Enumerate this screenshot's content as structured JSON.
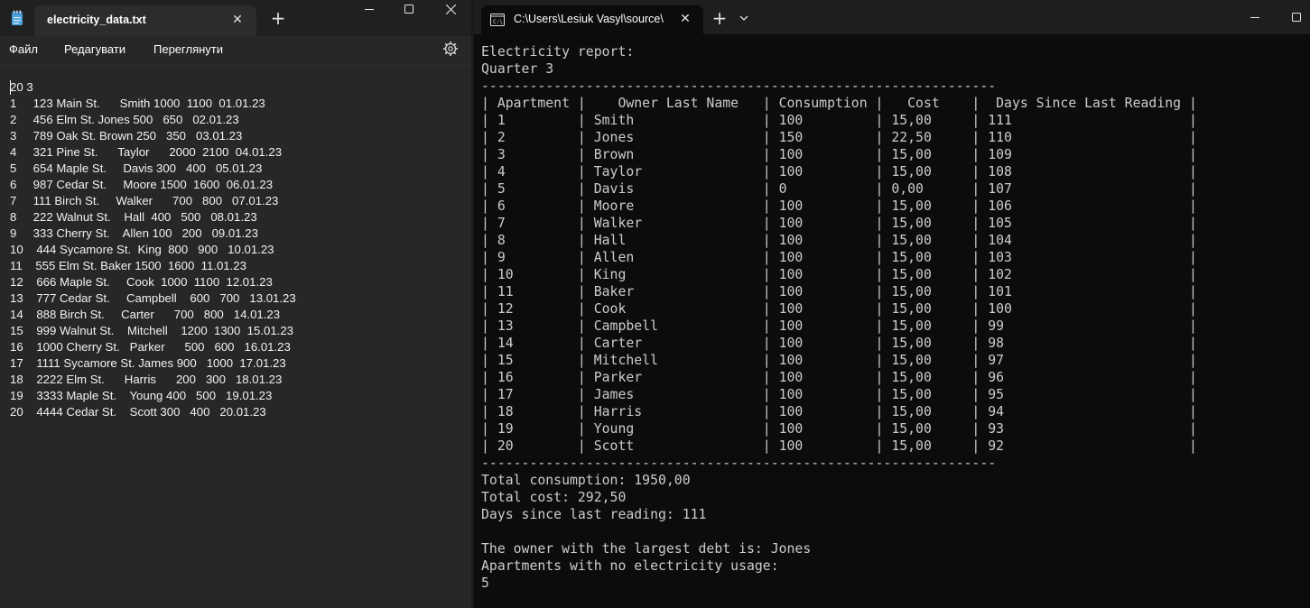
{
  "notepad": {
    "tab_title": "electricity_data.txt",
    "menu": [
      "Файл",
      "Редагувати",
      "Переглянути"
    ],
    "lines": [
      "20 3",
      "1     123 Main St.      Smith 1000  1100  01.01.23",
      "2     456 Elm St. Jones 500   650   02.01.23",
      "3     789 Oak St. Brown 250   350   03.01.23",
      "4     321 Pine St.      Taylor      2000  2100  04.01.23",
      "5     654 Maple St.     Davis 300   400   05.01.23",
      "6     987 Cedar St.     Moore 1500  1600  06.01.23",
      "7     111 Birch St.     Walker      700   800   07.01.23",
      "8     222 Walnut St.    Hall  400   500   08.01.23",
      "9     333 Cherry St.    Allen 100   200   09.01.23",
      "10    444 Sycamore St.  King  800   900   10.01.23",
      "11    555 Elm St. Baker 1500  1600  11.01.23",
      "12    666 Maple St.     Cook  1000  1100  12.01.23",
      "13    777 Cedar St.     Campbell    600   700   13.01.23",
      "14    888 Birch St.     Carter      700   800   14.01.23",
      "15    999 Walnut St.    Mitchell    1200  1300  15.01.23",
      "16    1000 Cherry St.   Parker      500   600   16.01.23",
      "17    1111 Sycamore St. James 900   1000  17.01.23",
      "18    2222 Elm St.      Harris      200   300   18.01.23",
      "19    3333 Maple St.    Young 400   500   19.01.23",
      "20    4444 Cedar St.    Scott 300   400   20.01.23"
    ]
  },
  "terminal": {
    "tab_title": "C:\\Users\\Lesiuk Vasyl\\source\\",
    "lines": [
      "Electricity report:",
      "Quarter 3",
      "----------------------------------------------------------------",
      "| Apartment |    Owner Last Name   | Consumption |   Cost    |  Days Since Last Reading |",
      "| 1         | Smith                | 100         | 15,00     | 111                      |",
      "| 2         | Jones                | 150         | 22,50     | 110                      |",
      "| 3         | Brown                | 100         | 15,00     | 109                      |",
      "| 4         | Taylor               | 100         | 15,00     | 108                      |",
      "| 5         | Davis                | 0           | 0,00      | 107                      |",
      "| 6         | Moore                | 100         | 15,00     | 106                      |",
      "| 7         | Walker               | 100         | 15,00     | 105                      |",
      "| 8         | Hall                 | 100         | 15,00     | 104                      |",
      "| 9         | Allen                | 100         | 15,00     | 103                      |",
      "| 10        | King                 | 100         | 15,00     | 102                      |",
      "| 11        | Baker                | 100         | 15,00     | 101                      |",
      "| 12        | Cook                 | 100         | 15,00     | 100                      |",
      "| 13        | Campbell             | 100         | 15,00     | 99                       |",
      "| 14        | Carter               | 100         | 15,00     | 98                       |",
      "| 15        | Mitchell             | 100         | 15,00     | 97                       |",
      "| 16        | Parker               | 100         | 15,00     | 96                       |",
      "| 17        | James                | 100         | 15,00     | 95                       |",
      "| 18        | Harris               | 100         | 15,00     | 94                       |",
      "| 19        | Young                | 100         | 15,00     | 93                       |",
      "| 20        | Scott                | 100         | 15,00     | 92                       |",
      "----------------------------------------------------------------",
      "Total consumption: 1950,00",
      "Total cost: 292,50",
      "Days since last reading: 111",
      "",
      "The owner with the largest debt is: Jones",
      "Apartments with no electricity usage:",
      "5"
    ]
  }
}
